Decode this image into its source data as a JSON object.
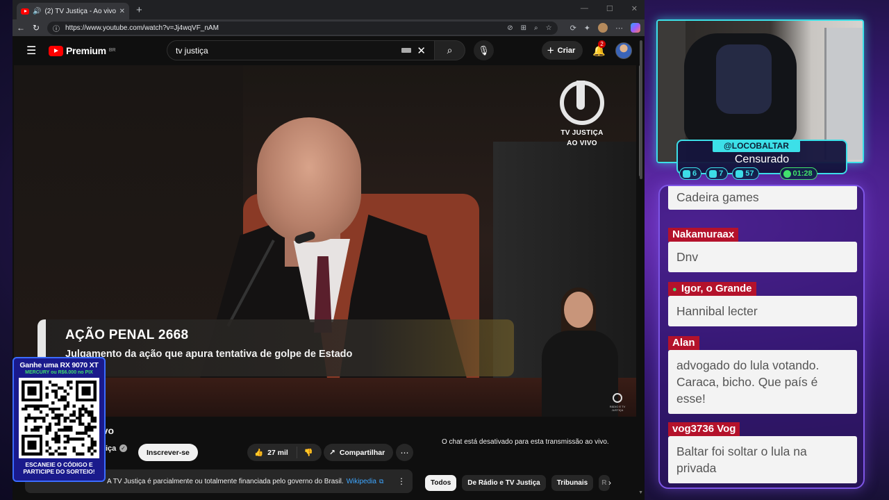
{
  "browser": {
    "tab_title": "(2) TV Justiça - Ao vivo - Yo",
    "url": "https://www.youtube.com/watch?v=Jj4wqVF_nAM"
  },
  "youtube": {
    "logo_text": "Premium",
    "region": "BR",
    "search_query": "tv justiça",
    "create_label": "Criar",
    "notification_count": "2"
  },
  "video": {
    "channel_logo_text_1": "TV JUSTIÇA",
    "channel_logo_text_2": "AO VIVO",
    "lower_third_title": "AÇÃO PENAL 2668",
    "lower_third_subtitle": "Julgamento da ação que apura tentativa de golpe de Estado",
    "small_logo_text": "RÁDIO E TV JUSTIÇA"
  },
  "below_video": {
    "title_fragment": "vivo",
    "channel_fragment": "iça",
    "subscribe_label": "Inscrever-se",
    "like_count": "27 mil",
    "share_label": "Compartilhar",
    "chat_disabled_text": "O chat está desativado para esta transmissão ao vivo.",
    "info_text": "A TV Justiça é parcialmente ou totalmente financiada pelo governo do Brasil.",
    "info_link": "Wikipedia",
    "chips": [
      "Todos",
      "De Rádio e TV Justiça",
      "Tribunais",
      "R"
    ]
  },
  "promo": {
    "title": "Ganhe uma RX 9070 XT",
    "subtitle": "MERCURY ou R$6.000 no PIX",
    "cta_line1": "ESCANEIE O CÓDIGO E",
    "cta_line2": "PARTICIPE DO SORTEIO!"
  },
  "stream_overlay": {
    "handle": "@LOCOBALTAR",
    "status": "Censurado",
    "stats": [
      {
        "value": "6",
        "icon": "twitch-icon"
      },
      {
        "value": "7",
        "icon": "youtube-icon"
      },
      {
        "value": "57",
        "icon": "kick-icon"
      },
      {
        "value": "01:28",
        "icon": "timer-icon"
      }
    ]
  },
  "chat": [
    {
      "user": "",
      "text": "Cadeira games"
    },
    {
      "user": "Nakamuraax",
      "text": "Dnv"
    },
    {
      "user": "Igor, o Grande",
      "text": "Hannibal lecter"
    },
    {
      "user": "Alan",
      "text": "advogado do lula votando. Caraca, bicho. Que país é esse!"
    },
    {
      "user": "vog3736 Vog",
      "text": "Baltar foi soltar o lula na privada"
    }
  ],
  "colors": {
    "accent_cyan": "#3ce0e8",
    "chat_user_red": "#b4122b",
    "youtube_red": "#ff0000"
  }
}
